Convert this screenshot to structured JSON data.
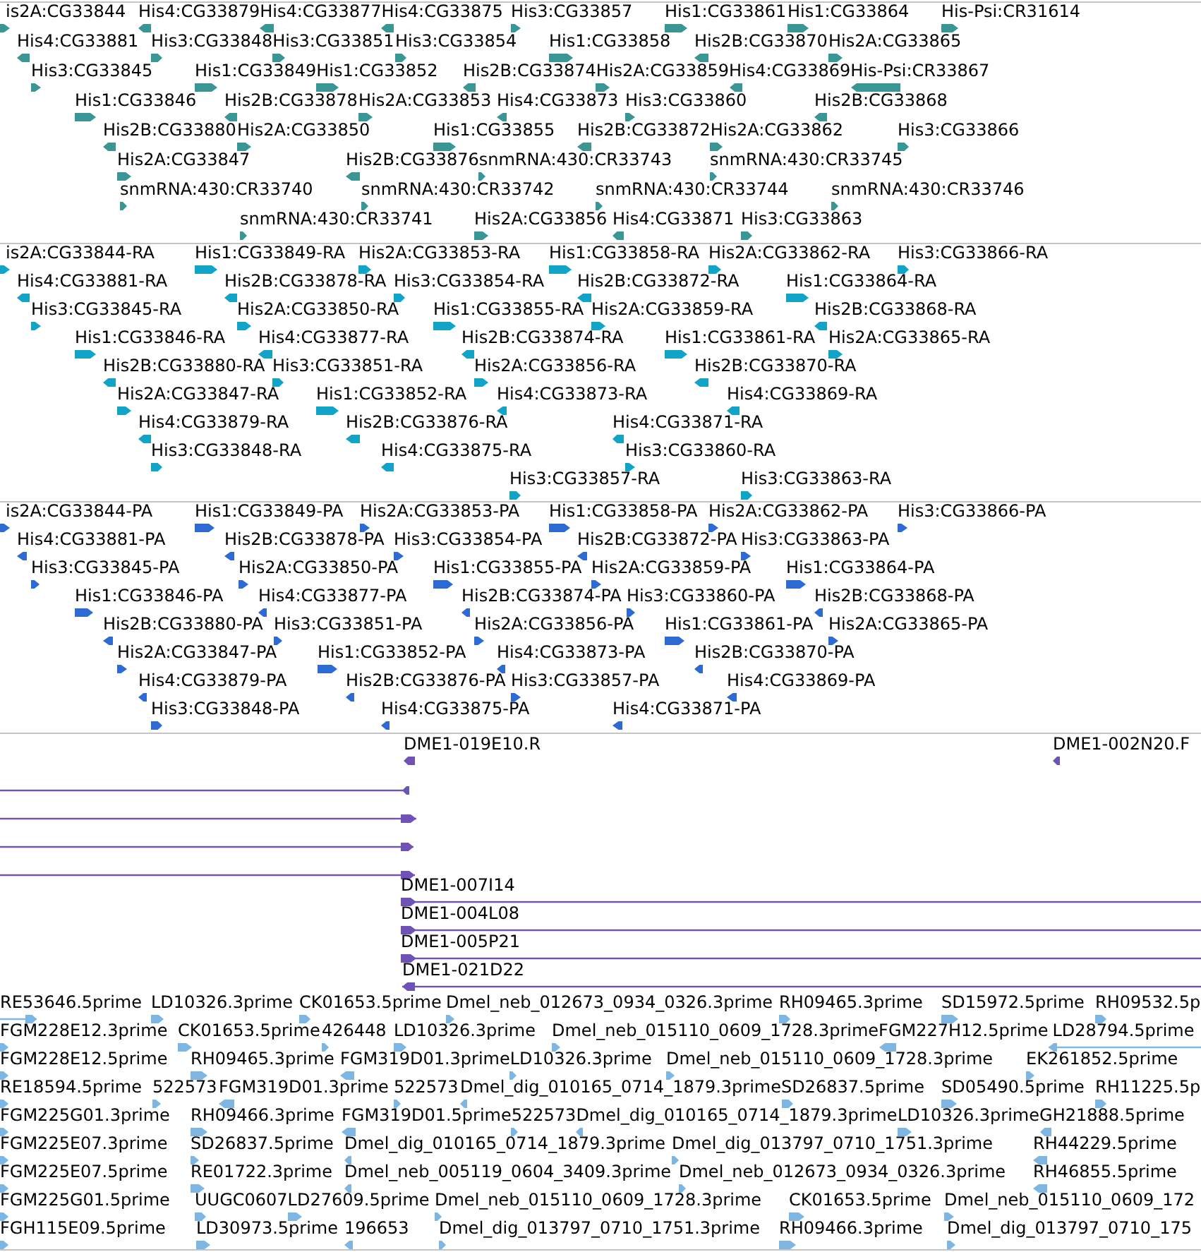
{
  "tracks": [
    {
      "color": "#3a9595",
      "rows": [
        {
          "features": [
            {
              "label": "is2A:CG33844",
              "reverse": false
            },
            {
              "label": "His4:CG33879",
              "reverse": true
            },
            {
              "label": "His4:CG33877",
              "reverse": true
            },
            {
              "label": "His4:CG33875",
              "reverse": true
            },
            {
              "label": "His3:CG33857",
              "reverse": false
            },
            {
              "label": "His1:CG33861",
              "reverse": false
            },
            {
              "label": "His1:CG33864",
              "reverse": false
            },
            {
              "label": "His-Psi:CR31614",
              "reverse": false
            }
          ]
        },
        {
          "features": [
            {
              "label": "His4:CG33881",
              "reverse": true
            },
            {
              "label": "His3:CG33848",
              "reverse": false
            },
            {
              "label": "His3:CG33851",
              "reverse": false
            },
            {
              "label": "His3:CG33854",
              "reverse": false
            },
            {
              "label": "His1:CG33858",
              "reverse": false
            },
            {
              "label": "His2B:CG33870",
              "reverse": true
            },
            {
              "label": "His2A:CG33865",
              "reverse": false
            }
          ]
        },
        {
          "features": [
            {
              "label": "His3:CG33845",
              "reverse": false
            },
            {
              "label": "His1:CG33849",
              "reverse": false
            },
            {
              "label": "His1:CG33852",
              "reverse": false
            },
            {
              "label": "His2B:CG33874",
              "reverse": true
            },
            {
              "label": "His2A:CG33859",
              "reverse": false
            },
            {
              "label": "His4:CG33869",
              "reverse": true
            },
            {
              "label": "His-Psi:CR33867",
              "reverse": true
            }
          ]
        },
        {
          "features": [
            {
              "label": "His1:CG33846",
              "reverse": false
            },
            {
              "label": "His2B:CG33878",
              "reverse": true
            },
            {
              "label": "His2A:CG33853",
              "reverse": false
            },
            {
              "label": "His4:CG33873",
              "reverse": true
            },
            {
              "label": "His3:CG33860",
              "reverse": false
            },
            {
              "label": "His2B:CG33868",
              "reverse": true
            }
          ]
        },
        {
          "features": [
            {
              "label": "His2B:CG33880",
              "reverse": true
            },
            {
              "label": "His2A:CG33850",
              "reverse": false
            },
            {
              "label": "His1:CG33855",
              "reverse": false
            },
            {
              "label": "His2B:CG33872",
              "reverse": true
            },
            {
              "label": "His2A:CG33862",
              "reverse": false
            },
            {
              "label": "His3:CG33866",
              "reverse": false
            }
          ]
        },
        {
          "features": [
            {
              "label": "His2A:CG33847",
              "reverse": false
            },
            {
              "label": "His2B:CG33876",
              "reverse": true
            },
            {
              "label": "snmRNA:430:CR33743",
              "reverse": false
            },
            {
              "label": "snmRNA:430:CR33745",
              "reverse": false
            }
          ]
        },
        {
          "features": [
            {
              "label": "snmRNA:430:CR33740",
              "reverse": false
            },
            {
              "label": "snmRNA:430:CR33742",
              "reverse": false
            },
            {
              "label": "snmRNA:430:CR33744",
              "reverse": false
            },
            {
              "label": "snmRNA:430:CR33746",
              "reverse": false
            }
          ]
        },
        {
          "features": [
            {
              "label": "snmRNA:430:CR33741",
              "reverse": false
            },
            {
              "label": "His2A:CG33856",
              "reverse": false
            },
            {
              "label": "His4:CG33871",
              "reverse": true
            },
            {
              "label": "His3:CG33863",
              "reverse": false
            }
          ]
        }
      ]
    },
    {
      "color": "#12a3c8",
      "rows": [
        {
          "features": [
            {
              "label": "is2A:CG33844-RA",
              "reverse": false
            },
            {
              "label": "His1:CG33849-RA",
              "reverse": false
            },
            {
              "label": "His2A:CG33853-RA",
              "reverse": false
            },
            {
              "label": "His1:CG33858-RA",
              "reverse": false
            },
            {
              "label": "His2A:CG33862-RA",
              "reverse": false
            },
            {
              "label": "His3:CG33866-RA",
              "reverse": false
            }
          ]
        },
        {
          "features": [
            {
              "label": "His4:CG33881-RA",
              "reverse": true
            },
            {
              "label": "His2B:CG33878-RA",
              "reverse": true
            },
            {
              "label": "His3:CG33854-RA",
              "reverse": false
            },
            {
              "label": "His2B:CG33872-RA",
              "reverse": true
            },
            {
              "label": "His1:CG33864-RA",
              "reverse": false
            }
          ]
        },
        {
          "features": [
            {
              "label": "His3:CG33845-RA",
              "reverse": false
            },
            {
              "label": "His2A:CG33850-RA",
              "reverse": false
            },
            {
              "label": "His1:CG33855-RA",
              "reverse": false
            },
            {
              "label": "His2A:CG33859-RA",
              "reverse": false
            },
            {
              "label": "His2B:CG33868-RA",
              "reverse": true
            }
          ]
        },
        {
          "features": [
            {
              "label": "His1:CG33846-RA",
              "reverse": false
            },
            {
              "label": "His4:CG33877-RA",
              "reverse": true
            },
            {
              "label": "His2B:CG33874-RA",
              "reverse": true
            },
            {
              "label": "His1:CG33861-RA",
              "reverse": false
            },
            {
              "label": "His2A:CG33865-RA",
              "reverse": false
            }
          ]
        },
        {
          "features": [
            {
              "label": "His2B:CG33880-RA",
              "reverse": true
            },
            {
              "label": "His3:CG33851-RA",
              "reverse": false
            },
            {
              "label": "His2A:CG33856-RA",
              "reverse": false
            },
            {
              "label": "His2B:CG33870-RA",
              "reverse": true
            }
          ]
        },
        {
          "features": [
            {
              "label": "His2A:CG33847-RA",
              "reverse": false
            },
            {
              "label": "His1:CG33852-RA",
              "reverse": false
            },
            {
              "label": "His4:CG33873-RA",
              "reverse": true
            },
            {
              "label": "His4:CG33869-RA",
              "reverse": true
            }
          ]
        },
        {
          "features": [
            {
              "label": "His4:CG33879-RA",
              "reverse": true
            },
            {
              "label": "His2B:CG33876-RA",
              "reverse": true
            },
            {
              "label": "His4:CG33871-RA",
              "reverse": true
            }
          ]
        },
        {
          "features": [
            {
              "label": "His3:CG33848-RA",
              "reverse": false
            },
            {
              "label": "His4:CG33875-RA",
              "reverse": true
            },
            {
              "label": "His3:CG33860-RA",
              "reverse": false
            }
          ]
        },
        {
          "features": [
            {
              "label": "His3:CG33857-RA",
              "reverse": false
            },
            {
              "label": "His3:CG33863-RA",
              "reverse": false
            }
          ]
        }
      ]
    },
    {
      "color": "#2d6ad4",
      "rows": [
        {
          "features": [
            {
              "label": "is2A:CG33844-PA",
              "reverse": false
            },
            {
              "label": "His1:CG33849-PA",
              "reverse": false
            },
            {
              "label": "His2A:CG33853-PA",
              "reverse": false
            },
            {
              "label": "His1:CG33858-PA",
              "reverse": false
            },
            {
              "label": "His2A:CG33862-PA",
              "reverse": false
            },
            {
              "label": "His3:CG33866-PA",
              "reverse": false
            }
          ]
        },
        {
          "features": [
            {
              "label": "His4:CG33881-PA",
              "reverse": true
            },
            {
              "label": "His2B:CG33878-PA",
              "reverse": true
            },
            {
              "label": "His3:CG33854-PA",
              "reverse": false
            },
            {
              "label": "His2B:CG33872-PA",
              "reverse": true
            },
            {
              "label": "His3:CG33863-PA",
              "reverse": false
            }
          ]
        },
        {
          "features": [
            {
              "label": "His3:CG33845-PA",
              "reverse": false
            },
            {
              "label": "His2A:CG33850-PA",
              "reverse": false
            },
            {
              "label": "His1:CG33855-PA",
              "reverse": false
            },
            {
              "label": "His2A:CG33859-PA",
              "reverse": false
            },
            {
              "label": "His1:CG33864-PA",
              "reverse": false
            }
          ]
        },
        {
          "features": [
            {
              "label": "His1:CG33846-PA",
              "reverse": false
            },
            {
              "label": "His4:CG33877-PA",
              "reverse": true
            },
            {
              "label": "His2B:CG33874-PA",
              "reverse": true
            },
            {
              "label": "His3:CG33860-PA",
              "reverse": false
            },
            {
              "label": "His2B:CG33868-PA",
              "reverse": true
            }
          ]
        },
        {
          "features": [
            {
              "label": "His2B:CG33880-PA",
              "reverse": true
            },
            {
              "label": "His3:CG33851-PA",
              "reverse": false
            },
            {
              "label": "His2A:CG33856-PA",
              "reverse": false
            },
            {
              "label": "His1:CG33861-PA",
              "reverse": false
            },
            {
              "label": "His2A:CG33865-PA",
              "reverse": false
            }
          ]
        },
        {
          "features": [
            {
              "label": "His2A:CG33847-PA",
              "reverse": false
            },
            {
              "label": "His1:CG33852-PA",
              "reverse": false
            },
            {
              "label": "His4:CG33873-PA",
              "reverse": true
            },
            {
              "label": "His2B:CG33870-PA",
              "reverse": true
            }
          ]
        },
        {
          "features": [
            {
              "label": "His4:CG33879-PA",
              "reverse": true
            },
            {
              "label": "His2B:CG33876-PA",
              "reverse": true
            },
            {
              "label": "His3:CG33857-PA",
              "reverse": false
            },
            {
              "label": "His4:CG33869-PA",
              "reverse": true
            }
          ]
        },
        {
          "features": [
            {
              "label": "His3:CG33848-PA",
              "reverse": false
            },
            {
              "label": "His4:CG33875-PA",
              "reverse": true
            },
            {
              "label": "His4:CG33871-PA",
              "reverse": true
            }
          ]
        }
      ]
    },
    {
      "color": "#6f52b5",
      "rows": [
        {
          "features": [
            {
              "label": "DME1-019E10.R",
              "reverse": true
            },
            {
              "label": "DME1-002N20.F",
              "reverse": true
            }
          ]
        },
        {
          "features": [
            {
              "reverse": true
            }
          ]
        },
        {
          "features": [
            {
              "reverse": false
            }
          ]
        },
        {
          "features": [
            {
              "reverse": false
            }
          ]
        },
        {
          "features": [
            {
              "reverse": false
            }
          ]
        },
        {
          "features": [
            {
              "label": "DME1-007I14",
              "reverse": false
            }
          ]
        },
        {
          "features": [
            {
              "label": "DME1-004L08",
              "reverse": false
            }
          ]
        },
        {
          "features": [
            {
              "label": "DME1-005P21",
              "reverse": false
            }
          ]
        },
        {
          "features": [
            {
              "label": "DME1-021D22",
              "reverse": true
            }
          ]
        }
      ]
    },
    {
      "color": "#7db6e3",
      "rows": [
        {
          "features": [
            {
              "label": "RE53646.5prime",
              "reverse": false
            },
            {
              "label": "LD10326.3prime",
              "reverse": false
            },
            {
              "label": "CK01653.5prime",
              "reverse": false
            },
            {
              "label": "Dmel_neb_012673_0934_0326.3prime",
              "reverse": false
            },
            {
              "label": "RH09465.3prime",
              "reverse": false
            },
            {
              "label": "SD15972.5prime",
              "reverse": false
            },
            {
              "label": "RH09532.5p",
              "reverse": false
            }
          ]
        },
        {
          "features": [
            {
              "label": "FGM228E12.3prime",
              "reverse": false
            },
            {
              "label": "CK01653.5prime",
              "reverse": false
            },
            {
              "label": "426448",
              "reverse": false
            },
            {
              "label": "LD10326.3prime",
              "reverse": false
            },
            {
              "label": "Dmel_neb_015110_0609_1728.3prime",
              "reverse": false
            },
            {
              "label": "FGM227H12.5prime",
              "reverse": true
            },
            {
              "label": "LD28794.5prime",
              "reverse": true
            }
          ]
        },
        {
          "features": [
            {
              "label": "FGM228E12.5prime",
              "reverse": false
            },
            {
              "label": "RH09465.3prime",
              "reverse": false
            },
            {
              "label": "FGM319D01.3prime",
              "reverse": true
            },
            {
              "label": "LD10326.3prime",
              "reverse": false
            },
            {
              "label": "Dmel_neb_015110_0609_1728.3prime",
              "reverse": false
            },
            {
              "label": "EK261852.5prime",
              "reverse": false
            }
          ]
        },
        {
          "features": [
            {
              "label": "RE18594.5prime",
              "reverse": false
            },
            {
              "label": "522573",
              "reverse": false
            },
            {
              "label": "FGM319D01.3prime",
              "reverse": true
            },
            {
              "label": "522573",
              "reverse": false
            },
            {
              "label": "Dmel_dig_010165_0714_1879.3prime",
              "reverse": true
            },
            {
              "label": "SD26837.5prime",
              "reverse": false
            },
            {
              "label": "SD05490.5prime",
              "reverse": false
            },
            {
              "label": "RH11225.5p",
              "reverse": false
            }
          ]
        },
        {
          "features": [
            {
              "label": "FGM225G01.3prime",
              "reverse": false
            },
            {
              "label": "RH09466.3prime",
              "reverse": false
            },
            {
              "label": "FGM319D01.5prime",
              "reverse": true
            },
            {
              "label": "522573",
              "reverse": false
            },
            {
              "label": "Dmel_dig_010165_0714_1879.3prime",
              "reverse": true
            },
            {
              "label": "LD10326.3prime",
              "reverse": false
            },
            {
              "label": "GH21888.5prime",
              "reverse": true
            }
          ]
        },
        {
          "features": [
            {
              "label": "FGM225E07.3prime",
              "reverse": false
            },
            {
              "label": "SD26837.5prime",
              "reverse": false
            },
            {
              "label": "Dmel_dig_010165_0714_1879.3prime",
              "reverse": true
            },
            {
              "label": "Dmel_dig_013797_0710_1751.3prime",
              "reverse": false
            },
            {
              "label": "RH44229.5prime",
              "reverse": true
            }
          ]
        },
        {
          "features": [
            {
              "label": "FGM225E07.5prime",
              "reverse": false
            },
            {
              "label": "RE01722.3prime",
              "reverse": false
            },
            {
              "label": "Dmel_neb_005119_0604_3409.3prime",
              "reverse": true
            },
            {
              "label": "Dmel_neb_012673_0934_0326.3prime",
              "reverse": false
            },
            {
              "label": "RH46855.5prime",
              "reverse": true
            }
          ]
        },
        {
          "features": [
            {
              "label": "FGM225G01.5prime",
              "reverse": false
            },
            {
              "label": "UUGC0607",
              "reverse": false
            },
            {
              "label": "LD27609.5prime",
              "reverse": false
            },
            {
              "label": "Dmel_neb_015110_0609_1728.3prime",
              "reverse": false
            },
            {
              "label": "CK01653.5prime",
              "reverse": false
            },
            {
              "label": "Dmel_neb_015110_0609_172",
              "reverse": false
            }
          ]
        },
        {
          "features": [
            {
              "label": "FGH115E09.5prime",
              "reverse": false
            },
            {
              "label": "LD30973.5prime",
              "reverse": false
            },
            {
              "label": "196653",
              "reverse": true
            },
            {
              "label": "Dmel_dig_013797_0710_1751.3prime",
              "reverse": false
            },
            {
              "label": "RH09466.3prime",
              "reverse": false
            },
            {
              "label": "Dmel_dig_013797_0710_175",
              "reverse": false
            }
          ]
        }
      ]
    }
  ]
}
